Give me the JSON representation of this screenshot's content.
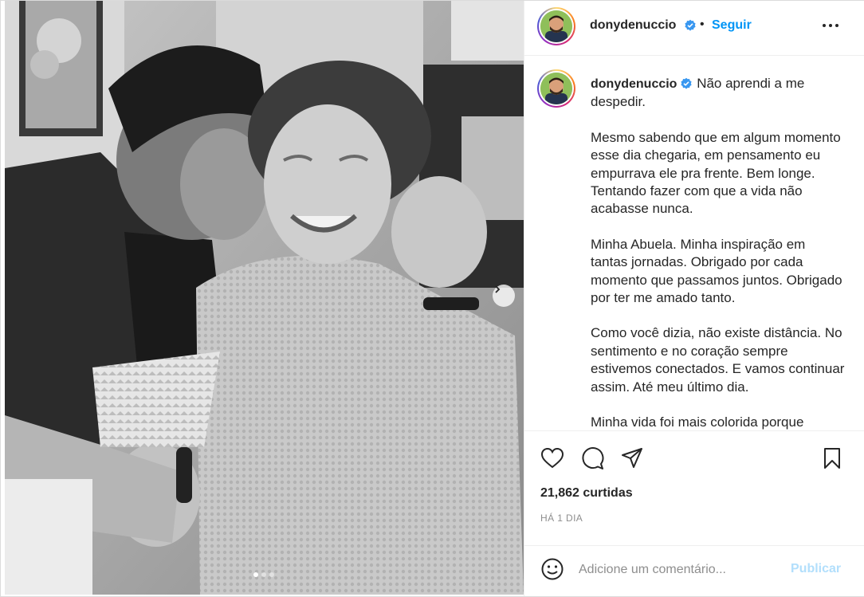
{
  "post": {
    "username": "donydenuccio",
    "follow_label": "Seguir",
    "separator": "•",
    "more_label": "•••",
    "caption": {
      "first_line": "Não aprendi a me despedir.",
      "paragraphs": [
        "Mesmo sabendo que em algum momento esse dia chegaria, em pensamento eu empurrava ele pra frente. Bem longe. Tentando fazer com que a vida não acabasse nunca.",
        "Minha Abuela. Minha inspiração em tantas jornadas. Obrigado por cada momento que passamos juntos. Obrigado por ter me amado tanto.",
        "Como você dizia, não existe distância. No sentimento e no coração sempre estivemos conectados. E vamos continuar assim. Até meu último dia.",
        "Minha vida foi mais colorida porque"
      ]
    },
    "likes": "21,862 curtidas",
    "time": "HÁ 1 DIA",
    "comment": {
      "placeholder": "Adicione um comentário...",
      "publish_label": "Publicar"
    },
    "carousel": {
      "slides": 3,
      "active": 1
    }
  },
  "icons": {
    "like": "heart-icon",
    "comment": "comment-icon",
    "share": "share-icon",
    "save": "bookmark-icon",
    "verified": "verified-badge-icon",
    "emoji": "emoji-icon",
    "next": "chevron-right-icon"
  },
  "colors": {
    "accent": "#0095f6",
    "publish_disabled": "#b2dffc",
    "muted": "#8e8e8e",
    "text": "#262626",
    "verified": "#3897f0"
  }
}
